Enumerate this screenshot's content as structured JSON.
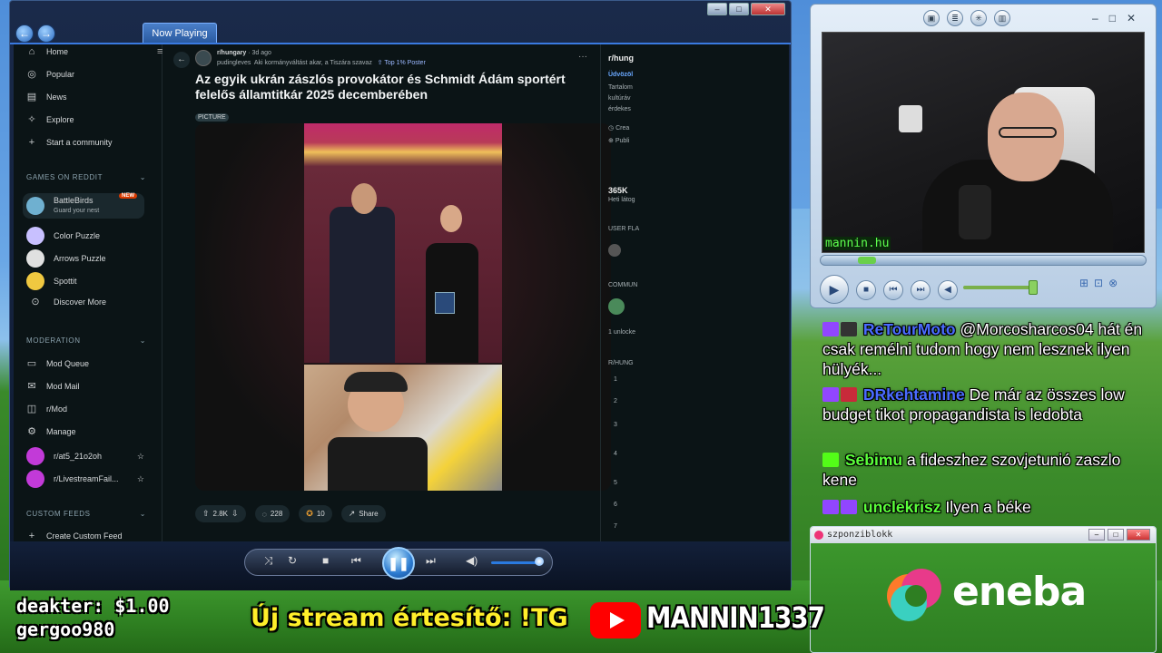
{
  "player": {
    "tab_label": "Now Playing",
    "win_min": "–",
    "win_max": "□",
    "win_close": "✕",
    "back": "←",
    "forward": "→"
  },
  "reddit": {
    "sidebar": {
      "menu_icon": "≡",
      "nav": [
        {
          "label": "Home",
          "icon": "home-icon",
          "glyph": "⌂"
        },
        {
          "label": "Popular",
          "icon": "popular-icon",
          "glyph": "◎"
        },
        {
          "label": "News",
          "icon": "news-icon",
          "glyph": "▤"
        },
        {
          "label": "Explore",
          "icon": "explore-icon",
          "glyph": "✧"
        },
        {
          "label": "Start a community",
          "icon": "plus-icon",
          "glyph": "+"
        }
      ],
      "games_heading": "GAMES ON REDDIT",
      "games": [
        {
          "label": "BattleBirds",
          "sub": "Guard your nest",
          "badge": "NEW",
          "color": "#6fb0d0"
        },
        {
          "label": "Color Puzzle",
          "color": "#c8c0ff"
        },
        {
          "label": "Arrows Puzzle",
          "color": "#e0e0e0"
        },
        {
          "label": "Spottit",
          "color": "#f0c840"
        },
        {
          "label": "Discover More",
          "glyph": "⊙"
        }
      ],
      "moderation_heading": "MODERATION",
      "moderation": [
        {
          "label": "Mod Queue",
          "glyph": "▭"
        },
        {
          "label": "Mod Mail",
          "glyph": "✉"
        },
        {
          "label": "r/Mod",
          "glyph": "◫"
        },
        {
          "label": "Manage",
          "glyph": "⚙"
        },
        {
          "label": "r/at5_21o2oh",
          "glyph": "☆"
        },
        {
          "label": "r/LivestreamFail...",
          "glyph": "☆"
        }
      ],
      "custom_heading": "CUSTOM FEEDS",
      "custom_item": "Create Custom Feed",
      "chevron": "⌄"
    },
    "post": {
      "subreddit": "r/hungary",
      "age": "· 3d ago",
      "author": "pudingleves",
      "author_flair": "Aki kormányváltást akar, a Tiszára szavaz",
      "badge": "Top 1% Poster",
      "title": "Az egyik ukrán zászlós provokátor és Schmidt Ádám sportért felelős államtitkár 2025 decemberében",
      "flair": "PICTURE",
      "more": "···",
      "upvotes": "2.8K",
      "comments": "228",
      "awards": "10",
      "share": "Share"
    },
    "right_panel": {
      "title": "r/hung",
      "lines": [
        "Üdvözöl",
        "Tartalom",
        "kultúráv",
        "érdekes",
        "Crea",
        "Publi"
      ],
      "members": "365K",
      "members_label": "Heti látog",
      "user_flair": "USER FLA",
      "community": "COMMUN",
      "unlocked": "1 unlocke",
      "rules": "R/HUNG",
      "rule_numbers": [
        "1",
        "2",
        "3",
        "4",
        "5",
        "6",
        "7"
      ]
    }
  },
  "cam": {
    "label": "mannin.hu",
    "win_controls": "–□✕"
  },
  "chat": [
    {
      "user": "ReTourMoto",
      "color": "#4a6bff",
      "badge_color": "#9146ff",
      "text": "@Morcosharcos04 hát én csak remélni tudom hogy nem lesznek ilyen hülyék..."
    },
    {
      "user": "DRkehtamine",
      "color": "#4a6bff",
      "badge_color": "#9146ff",
      "text": "De már az összes low budget tikot propagandista is ledobta"
    },
    {
      "user": "Sebimu",
      "color": "#5aff3a",
      "badge_color": "#53fc18",
      "text": "a fideszhez szovjetunió zaszlo kene"
    },
    {
      "user": "unclekrisz",
      "color": "#5aff3a",
      "badge_color": "#9146ff",
      "text": "Ilyen a béke"
    }
  ],
  "sponsor": {
    "window_title": "szponziblokk",
    "brand": "eneba"
  },
  "overlay": {
    "donor1": "deakter: $1.00",
    "donor2": "gergoo980",
    "notify": "Új stream értesítő: !TG",
    "channel": "MANNIN1337"
  }
}
